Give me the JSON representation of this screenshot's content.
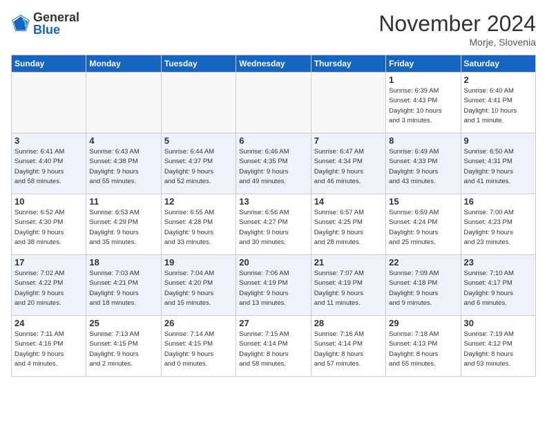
{
  "header": {
    "logo_general": "General",
    "logo_blue": "Blue",
    "month_title": "November 2024",
    "location": "Morje, Slovenia"
  },
  "days_of_week": [
    "Sunday",
    "Monday",
    "Tuesday",
    "Wednesday",
    "Thursday",
    "Friday",
    "Saturday"
  ],
  "weeks": [
    [
      {
        "day": "",
        "info": "",
        "empty": true
      },
      {
        "day": "",
        "info": "",
        "empty": true
      },
      {
        "day": "",
        "info": "",
        "empty": true
      },
      {
        "day": "",
        "info": "",
        "empty": true
      },
      {
        "day": "",
        "info": "",
        "empty": true
      },
      {
        "day": "1",
        "info": "Sunrise: 6:39 AM\nSunset: 4:43 PM\nDaylight: 10 hours\nand 3 minutes."
      },
      {
        "day": "2",
        "info": "Sunrise: 6:40 AM\nSunset: 4:41 PM\nDaylight: 10 hours\nand 1 minute."
      }
    ],
    [
      {
        "day": "3",
        "info": "Sunrise: 6:41 AM\nSunset: 4:40 PM\nDaylight: 9 hours\nand 58 minutes."
      },
      {
        "day": "4",
        "info": "Sunrise: 6:43 AM\nSunset: 4:38 PM\nDaylight: 9 hours\nand 55 minutes."
      },
      {
        "day": "5",
        "info": "Sunrise: 6:44 AM\nSunset: 4:37 PM\nDaylight: 9 hours\nand 52 minutes."
      },
      {
        "day": "6",
        "info": "Sunrise: 6:46 AM\nSunset: 4:35 PM\nDaylight: 9 hours\nand 49 minutes."
      },
      {
        "day": "7",
        "info": "Sunrise: 6:47 AM\nSunset: 4:34 PM\nDaylight: 9 hours\nand 46 minutes."
      },
      {
        "day": "8",
        "info": "Sunrise: 6:49 AM\nSunset: 4:33 PM\nDaylight: 9 hours\nand 43 minutes."
      },
      {
        "day": "9",
        "info": "Sunrise: 6:50 AM\nSunset: 4:31 PM\nDaylight: 9 hours\nand 41 minutes."
      }
    ],
    [
      {
        "day": "10",
        "info": "Sunrise: 6:52 AM\nSunset: 4:30 PM\nDaylight: 9 hours\nand 38 minutes."
      },
      {
        "day": "11",
        "info": "Sunrise: 6:53 AM\nSunset: 4:29 PM\nDaylight: 9 hours\nand 35 minutes."
      },
      {
        "day": "12",
        "info": "Sunrise: 6:55 AM\nSunset: 4:28 PM\nDaylight: 9 hours\nand 33 minutes."
      },
      {
        "day": "13",
        "info": "Sunrise: 6:56 AM\nSunset: 4:27 PM\nDaylight: 9 hours\nand 30 minutes."
      },
      {
        "day": "14",
        "info": "Sunrise: 6:57 AM\nSunset: 4:25 PM\nDaylight: 9 hours\nand 28 minutes."
      },
      {
        "day": "15",
        "info": "Sunrise: 6:59 AM\nSunset: 4:24 PM\nDaylight: 9 hours\nand 25 minutes."
      },
      {
        "day": "16",
        "info": "Sunrise: 7:00 AM\nSunset: 4:23 PM\nDaylight: 9 hours\nand 23 minutes."
      }
    ],
    [
      {
        "day": "17",
        "info": "Sunrise: 7:02 AM\nSunset: 4:22 PM\nDaylight: 9 hours\nand 20 minutes."
      },
      {
        "day": "18",
        "info": "Sunrise: 7:03 AM\nSunset: 4:21 PM\nDaylight: 9 hours\nand 18 minutes."
      },
      {
        "day": "19",
        "info": "Sunrise: 7:04 AM\nSunset: 4:20 PM\nDaylight: 9 hours\nand 15 minutes."
      },
      {
        "day": "20",
        "info": "Sunrise: 7:06 AM\nSunset: 4:19 PM\nDaylight: 9 hours\nand 13 minutes."
      },
      {
        "day": "21",
        "info": "Sunrise: 7:07 AM\nSunset: 4:19 PM\nDaylight: 9 hours\nand 11 minutes."
      },
      {
        "day": "22",
        "info": "Sunrise: 7:09 AM\nSunset: 4:18 PM\nDaylight: 9 hours\nand 9 minutes."
      },
      {
        "day": "23",
        "info": "Sunrise: 7:10 AM\nSunset: 4:17 PM\nDaylight: 9 hours\nand 6 minutes."
      }
    ],
    [
      {
        "day": "24",
        "info": "Sunrise: 7:11 AM\nSunset: 4:16 PM\nDaylight: 9 hours\nand 4 minutes."
      },
      {
        "day": "25",
        "info": "Sunrise: 7:13 AM\nSunset: 4:15 PM\nDaylight: 9 hours\nand 2 minutes."
      },
      {
        "day": "26",
        "info": "Sunrise: 7:14 AM\nSunset: 4:15 PM\nDaylight: 9 hours\nand 0 minutes."
      },
      {
        "day": "27",
        "info": "Sunrise: 7:15 AM\nSunset: 4:14 PM\nDaylight: 8 hours\nand 58 minutes."
      },
      {
        "day": "28",
        "info": "Sunrise: 7:16 AM\nSunset: 4:14 PM\nDaylight: 8 hours\nand 57 minutes."
      },
      {
        "day": "29",
        "info": "Sunrise: 7:18 AM\nSunset: 4:13 PM\nDaylight: 8 hours\nand 55 minutes."
      },
      {
        "day": "30",
        "info": "Sunrise: 7:19 AM\nSunset: 4:12 PM\nDaylight: 8 hours\nand 53 minutes."
      }
    ]
  ]
}
